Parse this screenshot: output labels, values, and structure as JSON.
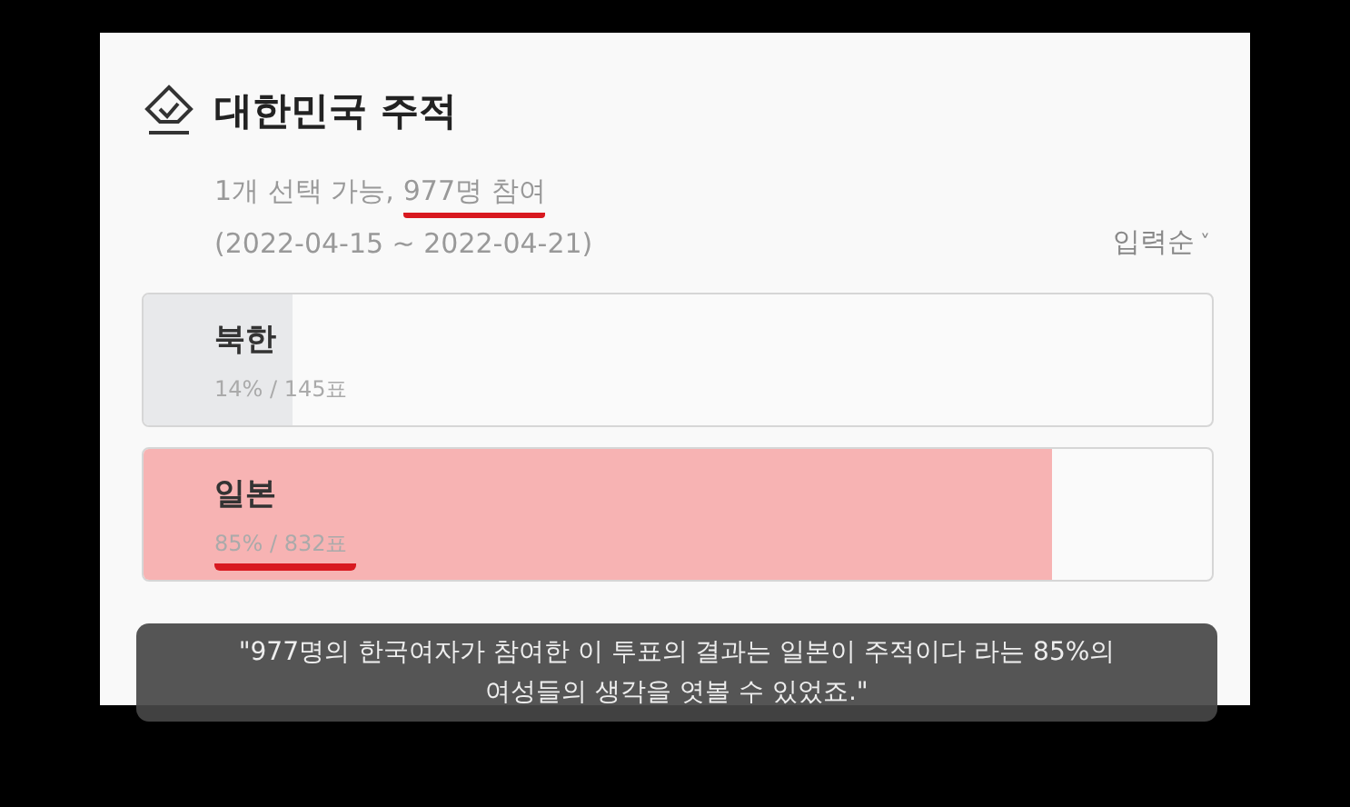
{
  "poll": {
    "title": "대한민국 주적",
    "meta": [
      {
        "text": "1개 선택 가능,",
        "highlighted": false
      },
      {
        "text": "977명 참여",
        "highlighted": true
      }
    ],
    "period": "(2022-04-15 ~ 2022-04-21)",
    "sort": {
      "label": "입력순",
      "caret": "˅"
    },
    "options": [
      {
        "label": "북한",
        "stats": "14% / 145표",
        "level": 0.14,
        "selected": false,
        "highlighted": false
      },
      {
        "label": "일본",
        "stats": "85% / 832표",
        "level": 0.85,
        "selected": true,
        "highlighted": true
      }
    ]
  },
  "caption": [
    "\"977명의 한국여자가 참여한 이 투표의 결과는 일본이 주적이다 라는 85%의",
    "여성들의 생각을 엿볼 수 있었죠.\""
  ]
}
